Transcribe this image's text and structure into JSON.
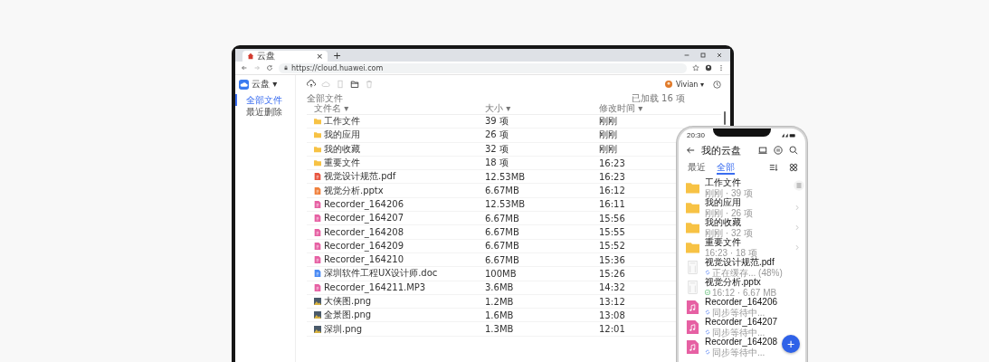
{
  "browser": {
    "tab": {
      "title": "云盘",
      "close": "×"
    },
    "new_tab": "+",
    "url": "https://cloud.huawei.com"
  },
  "app": {
    "logo": "云盘",
    "logo_caret": "▾",
    "user": "Vivian",
    "user_caret": "▾",
    "sidebar": [
      {
        "label": "全部文件",
        "selected": true
      },
      {
        "label": "最近删除",
        "selected": false
      }
    ],
    "toolbar": [
      {
        "kind": "upload",
        "disabled": false
      },
      {
        "kind": "cloud",
        "disabled": true
      },
      {
        "kind": "copy",
        "disabled": true
      },
      {
        "kind": "folder",
        "disabled": false
      },
      {
        "kind": "trash",
        "disabled": true
      }
    ],
    "breadcrumb": "全部文件",
    "loaded": "已加载 16 项",
    "columns": [
      "文件名 ▾",
      "大小 ▾",
      "修改时间 ▾"
    ],
    "rows": [
      {
        "kind": "folder",
        "name": "工作文件",
        "size": "39 项",
        "time": "刚刚"
      },
      {
        "kind": "folder",
        "name": "我的应用",
        "size": "26 项",
        "time": "刚刚"
      },
      {
        "kind": "folder",
        "name": "我的收藏",
        "size": "32 项",
        "time": "刚刚"
      },
      {
        "kind": "folder",
        "name": "重要文件",
        "size": "18 项",
        "time": "16:23"
      },
      {
        "kind": "pdf",
        "name": "视觉设计规范.pdf",
        "size": "12.53MB",
        "time": "16:23"
      },
      {
        "kind": "ppt",
        "name": "视觉分析.pptx",
        "size": "6.67MB",
        "time": "16:12"
      },
      {
        "kind": "audio",
        "name": "Recorder_164206",
        "size": "12.53MB",
        "time": "16:11"
      },
      {
        "kind": "audio",
        "name": "Recorder_164207",
        "size": "6.67MB",
        "time": "15:56"
      },
      {
        "kind": "audio",
        "name": "Recorder_164208",
        "size": "6.67MB",
        "time": "15:55"
      },
      {
        "kind": "audio",
        "name": "Recorder_164209",
        "size": "6.67MB",
        "time": "15:52"
      },
      {
        "kind": "audio",
        "name": "Recorder_164210",
        "size": "6.67MB",
        "time": "15:36"
      },
      {
        "kind": "doc",
        "name": "深圳软件工程UX设计师.doc",
        "size": "100MB",
        "time": "15:26"
      },
      {
        "kind": "audio",
        "name": "Recorder_164211.MP3",
        "size": "3.6MB",
        "time": "14:32"
      },
      {
        "kind": "image",
        "name": "大侠图.png",
        "size": "1.2MB",
        "time": "13:12"
      },
      {
        "kind": "image",
        "name": "全景图.png",
        "size": "1.6MB",
        "time": "13:08"
      },
      {
        "kind": "image",
        "name": "深圳.png",
        "size": "1.3MB",
        "time": "12:01"
      }
    ]
  },
  "phone": {
    "time": "20:30",
    "title": "我的云盘",
    "tabs": [
      {
        "label": "最近",
        "selected": false
      },
      {
        "label": "全部",
        "selected": true
      }
    ],
    "fab": "+",
    "items": [
      {
        "kind": "folder",
        "name": "工作文件",
        "sub": "刚刚 · 39 项",
        "chevron": false
      },
      {
        "kind": "folder",
        "name": "我的应用",
        "sub": "刚刚 · 26 项",
        "chevron": true
      },
      {
        "kind": "folder",
        "name": "我的收藏",
        "sub": "刚刚 · 32 项",
        "chevron": true
      },
      {
        "kind": "folder",
        "name": "重要文件",
        "sub": "16:23 · 18 项",
        "chevron": true
      },
      {
        "kind": "doc",
        "name": "视觉设计规范.pdf",
        "sub": "正在缓存... (48%)",
        "synced": false,
        "chevron": false
      },
      {
        "kind": "doc",
        "name": "视觉分析.pptx",
        "sub": "16:12 · 6.67 MB",
        "synced": true,
        "chevron": false
      },
      {
        "kind": "audio",
        "name": "Recorder_164206",
        "sub": "同步等待中...",
        "synced": false,
        "chevron": false
      },
      {
        "kind": "audio",
        "name": "Recorder_164207",
        "sub": "同步等待中...",
        "synced": false,
        "chevron": false
      },
      {
        "kind": "audio",
        "name": "Recorder_164208",
        "sub": "同步等待中...",
        "synced": false,
        "chevron": false
      }
    ]
  }
}
